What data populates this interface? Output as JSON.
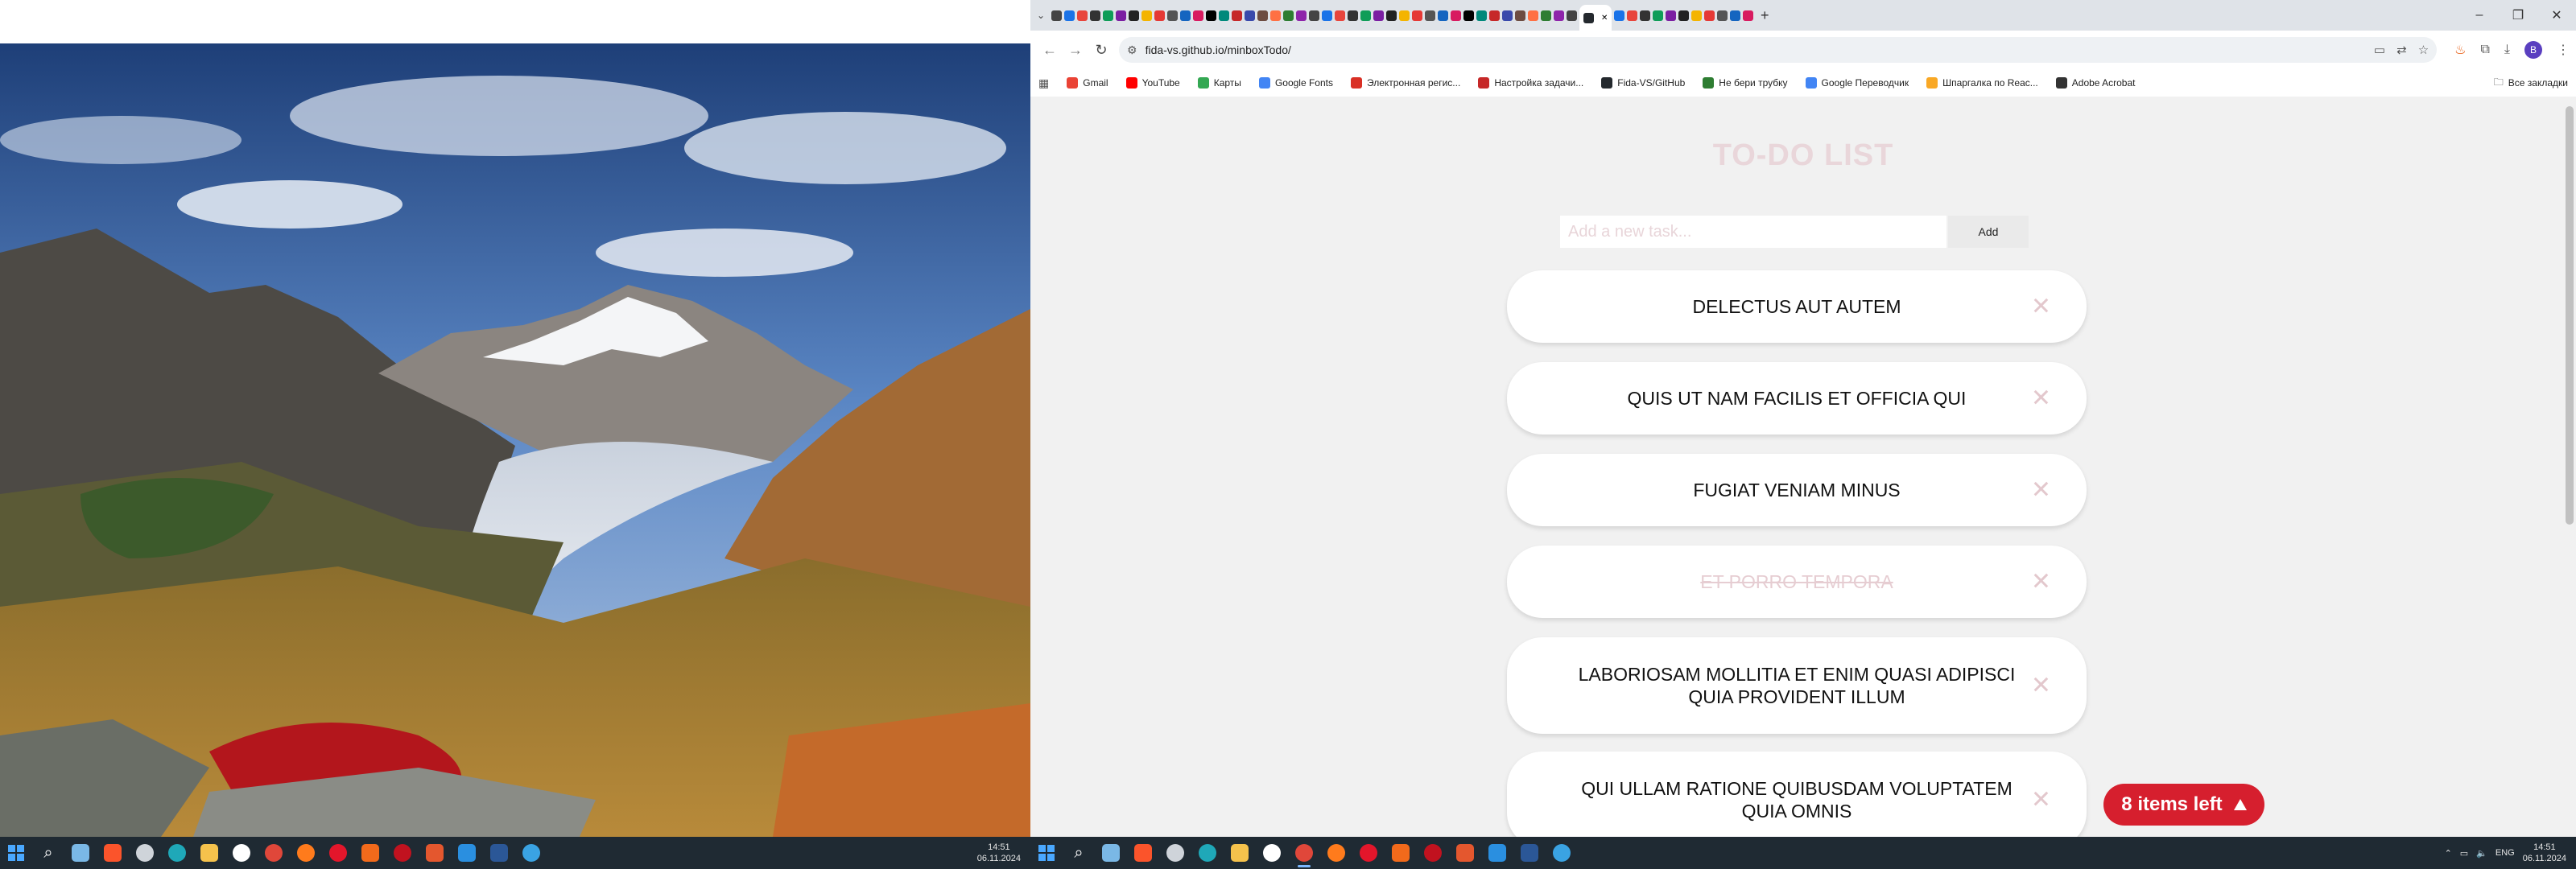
{
  "browser": {
    "url": "fida-vs.github.io/minboxTodo/",
    "bookmarks": [
      {
        "label": "Gmail",
        "color": "#ea4335"
      },
      {
        "label": "YouTube",
        "color": "#ff0000"
      },
      {
        "label": "Карты",
        "color": "#34a853"
      },
      {
        "label": "Google Fonts",
        "color": "#4285f4"
      },
      {
        "label": "Электронная регис...",
        "color": "#d93025"
      },
      {
        "label": "Настройка задачи...",
        "color": "#c62828"
      },
      {
        "label": "Fida-VS/GitHub",
        "color": "#24292e"
      },
      {
        "label": "Не бери трубку",
        "color": "#2e7d32"
      },
      {
        "label": "Google Переводчик",
        "color": "#4285f4"
      },
      {
        "label": "Шпаргалка по Reac...",
        "color": "#f9a825"
      },
      {
        "label": "Adobe Acrobat",
        "color": "#333333"
      }
    ],
    "bookmarks_all": "Все закладки"
  },
  "todo_app": {
    "title": "TO-DO LIST",
    "input_placeholder": "Add a new task...",
    "add_label": "Add",
    "items": [
      {
        "text": "DELECTUS AUT AUTEM",
        "done": false
      },
      {
        "text": "QUIS UT NAM FACILIS ET OFFICIA QUI",
        "done": false
      },
      {
        "text": "FUGIAT VENIAM MINUS",
        "done": false
      },
      {
        "text": "ET PORRO TEMPORA",
        "done": true
      },
      {
        "text": "LABORIOSAM MOLLITIA ET ENIM QUASI ADIPISCI QUIA PROVIDENT ILLUM",
        "done": false
      },
      {
        "text": "QUI ULLAM RATIONE QUIBUSDAM VOLUPTATEM QUIA OMNIS",
        "done": false
      }
    ],
    "remove_glyph": "✕",
    "items_left": "8 items left",
    "accent_color": "#d61f2e"
  },
  "taskbar_left": {
    "time": "14:51",
    "date": "06.11.2024"
  },
  "taskbar_right": {
    "lang": "ENG",
    "time": "14:51",
    "date": "06.11.2024"
  }
}
